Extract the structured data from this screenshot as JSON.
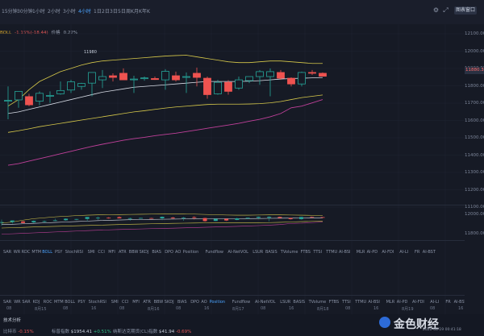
{
  "toolbar": {
    "timeframes": [
      "15分钟",
      "30分钟",
      "1小时",
      "2小时",
      "3小时",
      "4小时",
      "1日",
      "2日",
      "3日",
      "5日",
      "周K",
      "月K",
      "年K"
    ],
    "active_timeframe": "4小时",
    "layout_button": "图表窗口",
    "icons": [
      "settings-icon",
      "fullscreen-icon"
    ]
  },
  "legend": {
    "label1": "BOLL",
    "label2": "价格",
    "values": [
      "-1.15%(-18.44)",
      "0.22%"
    ]
  },
  "price_axis": {
    "ticks": [
      "12100.00",
      "12000.00",
      "11900.00",
      "11800.00",
      "11700.00",
      "11600.00",
      "11500.00",
      "11400.00",
      "11300.00",
      "11200.00",
      "11100.00"
    ],
    "current_price": "11880.36",
    "sub_ticks": [
      "12000.00",
      "11800.00"
    ]
  },
  "chart_annotation": "11980",
  "indicators_row1": [
    "SAR",
    "WR",
    "RDC",
    "MTM",
    "BOLL",
    "PSY",
    "StochRSI",
    "SMI",
    "CCI",
    "MFI",
    "ATR",
    "BBW",
    "SKDJ",
    "BIAS",
    "DPO",
    "AO",
    "Position",
    "Fundflow",
    "AI-NetVOL",
    "LSUR",
    "BASIS",
    "TVolume",
    "FTBS",
    "TTSI",
    "TTMU",
    "AI-BSI",
    "MLR",
    "AI-PD",
    "AI-FDI",
    "AI-LI",
    "FR",
    "AI-BST"
  ],
  "indicators_row2": [
    "SAR",
    "WR",
    "SAR",
    "KDJ",
    "ROC",
    "MTM",
    "BOLL",
    "PSY",
    "StochRSI",
    "SMI",
    "CCI",
    "MFI",
    "ATR",
    "BBW",
    "SKDJ",
    "BIAS",
    "DPO",
    "AO",
    "Position",
    "Fundflow",
    "AI-NetVOL",
    "LSUR",
    "BASIS",
    "TVolume",
    "FTBS",
    "TTSI",
    "TTMU",
    "AI-BSI",
    "MLR",
    "AI-PD",
    "AI-FDI",
    "AI-LI",
    "FR",
    "AI-BST"
  ],
  "active_indicator_row1": "BOLL",
  "active_indicator_row2": "Position",
  "date_axis": [
    "08",
    "8月15",
    "08",
    "16",
    "08",
    "8月16",
    "08",
    "16",
    "8月17",
    "08",
    "16",
    "8月18",
    "08",
    "16",
    "8月19",
    "08",
    "16"
  ],
  "footer": {
    "title": "技术分析",
    "item1_label": "比特币",
    "item1_change": "-0.15%",
    "item2_label": "标普指数",
    "item2_value": "$1954.41",
    "item2_change": "+0.51%",
    "item3_label": "纳斯达克期货(CL)指数",
    "item3_value": "$41.94",
    "item3_change": "-0.69%",
    "brand": "金色财经",
    "brand_sub": "2020-08-19 00:41:18"
  },
  "chart_data": {
    "type": "candlestick",
    "ylim": [
      11100,
      12150
    ],
    "candles": [
      {
        "o": 11735,
        "h": 11820,
        "l": 11620,
        "c": 11735
      },
      {
        "o": 11738,
        "h": 11790,
        "l": 11690,
        "c": 11790
      },
      {
        "o": 11758,
        "h": 11775,
        "l": 11700,
        "c": 11708
      },
      {
        "o": 11730,
        "h": 11790,
        "l": 11705,
        "c": 11778
      },
      {
        "o": 11765,
        "h": 11790,
        "l": 11720,
        "c": 11765
      },
      {
        "o": 11775,
        "h": 11850,
        "l": 11770,
        "c": 11795
      },
      {
        "o": 11798,
        "h": 11860,
        "l": 11780,
        "c": 11848
      },
      {
        "o": 11820,
        "h": 11842,
        "l": 11800,
        "c": 11838
      },
      {
        "o": 11840,
        "h": 11905,
        "l": 11760,
        "c": 11905
      },
      {
        "o": 11860,
        "h": 11920,
        "l": 11810,
        "c": 11880
      },
      {
        "o": 11885,
        "h": 11900,
        "l": 11850,
        "c": 11875
      },
      {
        "o": 11900,
        "h": 11930,
        "l": 11860,
        "c": 11860
      },
      {
        "o": 11865,
        "h": 11885,
        "l": 11780,
        "c": 11865
      },
      {
        "o": 11868,
        "h": 11880,
        "l": 11855,
        "c": 11872
      },
      {
        "o": 11868,
        "h": 11880,
        "l": 11860,
        "c": 11862
      },
      {
        "o": 11860,
        "h": 11925,
        "l": 11800,
        "c": 11912
      },
      {
        "o": 11885,
        "h": 11910,
        "l": 11850,
        "c": 11860
      },
      {
        "o": 11880,
        "h": 11905,
        "l": 11780,
        "c": 11880
      },
      {
        "o": 11900,
        "h": 11935,
        "l": 11820,
        "c": 11875
      },
      {
        "o": 11870,
        "h": 11880,
        "l": 11745,
        "c": 11770
      },
      {
        "o": 11775,
        "h": 11860,
        "l": 11770,
        "c": 11845
      },
      {
        "o": 11845,
        "h": 11858,
        "l": 11770,
        "c": 11790
      },
      {
        "o": 11810,
        "h": 11880,
        "l": 11800,
        "c": 11860
      },
      {
        "o": 11855,
        "h": 11880,
        "l": 11840,
        "c": 11880
      },
      {
        "o": 11880,
        "h": 11920,
        "l": 11830,
        "c": 11910
      },
      {
        "o": 11880,
        "h": 11930,
        "l": 11760,
        "c": 11910
      },
      {
        "o": 11905,
        "h": 11920,
        "l": 11860,
        "c": 11870
      },
      {
        "o": 11870,
        "h": 11875,
        "l": 11820,
        "c": 11835
      },
      {
        "o": 11835,
        "h": 11910,
        "l": 11820,
        "c": 11905
      },
      {
        "o": 11905,
        "h": 11920,
        "l": 11890,
        "c": 11900
      },
      {
        "o": 11900,
        "h": 11905,
        "l": 11880,
        "c": 11882
      }
    ],
    "boll_upper": [
      11700,
      11740,
      11800,
      11850,
      11880,
      11910,
      11930,
      11950,
      11965,
      11975,
      11980,
      11985,
      11990,
      11995,
      12000,
      12005,
      12008,
      12010,
      12000,
      11990,
      11980,
      11970,
      11965,
      11965,
      11970,
      11975,
      11975,
      11970,
      11965,
      11960,
      11960
    ],
    "boll_mid": [
      11655,
      11665,
      11680,
      11695,
      11710,
      11725,
      11740,
      11755,
      11770,
      11785,
      11795,
      11805,
      11815,
      11820,
      11825,
      11830,
      11835,
      11840,
      11845,
      11850,
      11850,
      11850,
      11850,
      11852,
      11855,
      11860,
      11865,
      11868,
      11870,
      11872,
      11874
    ],
    "ma_yellow": [
      11540,
      11550,
      11562,
      11575,
      11585,
      11595,
      11605,
      11615,
      11625,
      11635,
      11645,
      11655,
      11665,
      11672,
      11680,
      11688,
      11695,
      11700,
      11705,
      11710,
      11712,
      11712,
      11712,
      11713,
      11715,
      11720,
      11728,
      11740,
      11752,
      11760,
      11768
    ],
    "ma_pink": [
      11340,
      11350,
      11365,
      11380,
      11395,
      11410,
      11425,
      11440,
      11455,
      11468,
      11480,
      11492,
      11502,
      11510,
      11520,
      11528,
      11535,
      11545,
      11555,
      11565,
      11575,
      11585,
      11595,
      11608,
      11620,
      11635,
      11655,
      11690,
      11700,
      11720,
      11740
    ]
  }
}
